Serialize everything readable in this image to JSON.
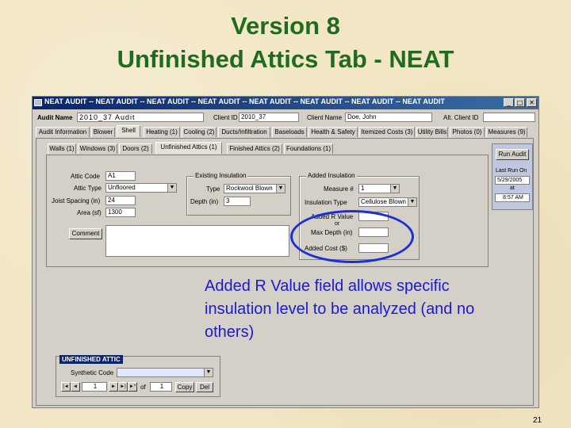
{
  "slide": {
    "title_line1": "Version 8",
    "title_line2": "Unfinished Attics Tab - NEAT",
    "page_number": "21"
  },
  "window": {
    "title": "NEAT AUDIT -- NEAT AUDIT -- NEAT AUDIT -- NEAT AUDIT -- NEAT AUDIT -- NEAT AUDIT -- NEAT AUDIT -- NEAT AUDIT",
    "controls": {
      "minimize": "_",
      "maximize": "□",
      "close": "✕"
    }
  },
  "header": {
    "audit_name_label": "Audit Name",
    "audit_name_value": "2010_37 Audit",
    "client_id_label": "Client ID",
    "client_id_value": "2010_37",
    "client_name_label": "Client Name",
    "client_name_value": "Doe, John",
    "alt_client_id_label": "Alt. Client ID",
    "alt_client_id_value": ""
  },
  "main_tabs": [
    {
      "label": "Audit Information"
    },
    {
      "label": "Blower"
    },
    {
      "label": "Shell",
      "active": true
    },
    {
      "label": "Heating (1)"
    },
    {
      "label": "Cooling (2)"
    },
    {
      "label": "Ducts/Infiltration"
    },
    {
      "label": "Baseloads"
    },
    {
      "label": "Health & Safety"
    },
    {
      "label": "Itemized Costs (3)"
    },
    {
      "label": "Utility Bills"
    },
    {
      "label": "Photos (0)"
    },
    {
      "label": "Measures (9)"
    }
  ],
  "sub_tabs": [
    {
      "label": "Walls (1)"
    },
    {
      "label": "Windows (3)"
    },
    {
      "label": "Doors (2)"
    },
    {
      "label": "Unfinished Attics (1)",
      "active": true
    },
    {
      "label": "Finished Attics (2)"
    },
    {
      "label": "Foundations (1)"
    }
  ],
  "attic_form": {
    "attic_code_label": "Attic Code",
    "attic_code_value": "A1",
    "attic_type_label": "Attic Type",
    "attic_type_value": "Unfloored",
    "joist_spacing_label": "Joist Spacing (in)",
    "joist_spacing_value": "24",
    "area_label": "Area (sf)",
    "area_value": "1300",
    "comment_button": "Comment",
    "comment_value": ""
  },
  "existing_insulation": {
    "group_title": "Existing Insulation",
    "type_label": "Type",
    "type_value": "Rockwool Blown",
    "depth_label": "Depth (in)",
    "depth_value": "3"
  },
  "added_insulation": {
    "group_title": "Added Insulation",
    "measure_label": "Measure #",
    "measure_value": "1",
    "insulation_type_label": "Insulation Type",
    "insulation_type_value": "Cellulose Blown",
    "added_r_value_label": "Added R Value",
    "added_r_value_value": "",
    "or_label": "or",
    "max_depth_label": "Max Depth (in)",
    "max_depth_value": "",
    "added_cost_label": "Added Cost ($)",
    "added_cost_value": ""
  },
  "run_panel": {
    "run_audit_button": "Run Audit",
    "last_run_label": "Last Run On",
    "last_run_date": "5/29/2005",
    "at_label": "at",
    "last_run_time": "8:57 AM"
  },
  "unfinished_attic_box": {
    "title": "UNFINISHED ATTIC",
    "synthetic_code_label": "Synthetic Code",
    "synthetic_code_value": "",
    "record_value": "1",
    "of_label": "of",
    "total_value": "1",
    "copy_button": "Copy",
    "delete_button": "Del",
    "nav_first": "|◄",
    "nav_prev": "◄",
    "nav_next": "►",
    "nav_last": "►|",
    "nav_new": "►*"
  },
  "annotation": {
    "text": "Added R Value field allows specific insulation level to be analyzed (and no others)"
  },
  "colors": {
    "title_green": "#1f6b1f",
    "annotation_blue": "#1a1ad0",
    "oval_blue": "#1a2fd6",
    "titlebar": "#0a246a",
    "form_face": "#d4d0c8"
  }
}
